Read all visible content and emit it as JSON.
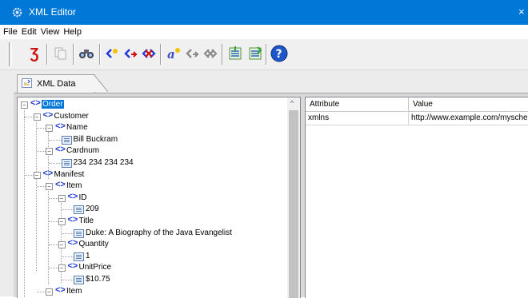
{
  "window": {
    "title": "XML Editor",
    "close_glyph": "×"
  },
  "menu": [
    "File",
    "Edit",
    "View",
    "Help"
  ],
  "toolbar": {
    "buttons": [
      "validate-icon",
      "copy-icon",
      "find-icon",
      "add-element-icon",
      "move-icon",
      "delete-element-icon",
      "add-attribute-icon",
      "move-attribute-icon",
      "delete-attribute-icon",
      "import-icon",
      "export-icon",
      "help-icon"
    ]
  },
  "tab": {
    "label": "XML Data"
  },
  "tree": [
    {
      "label": "Order",
      "depth": 0,
      "type": "root",
      "selected": true
    },
    {
      "label": "Customer",
      "depth": 1,
      "type": "element"
    },
    {
      "label": "Name",
      "depth": 2,
      "type": "element"
    },
    {
      "label": "Bill Buckram",
      "depth": 3,
      "type": "text"
    },
    {
      "label": "Cardnum",
      "depth": 2,
      "type": "attr-element"
    },
    {
      "label": "234 234 234 234",
      "depth": 3,
      "type": "text"
    },
    {
      "label": "Manifest",
      "depth": 1,
      "type": "element"
    },
    {
      "label": "Item",
      "depth": 2,
      "type": "element"
    },
    {
      "label": "ID",
      "depth": 3,
      "type": "element"
    },
    {
      "label": "209",
      "depth": 4,
      "type": "text"
    },
    {
      "label": "Title",
      "depth": 3,
      "type": "element"
    },
    {
      "label": "Duke: A Biography of the Java Evangelist",
      "depth": 4,
      "type": "text"
    },
    {
      "label": "Quantity",
      "depth": 3,
      "type": "element"
    },
    {
      "label": "1",
      "depth": 4,
      "type": "text"
    },
    {
      "label": "UnitPrice",
      "depth": 3,
      "type": "element"
    },
    {
      "label": "$10.75",
      "depth": 4,
      "type": "text"
    },
    {
      "label": "Item",
      "depth": 2,
      "type": "element"
    }
  ],
  "attributes": {
    "headers": [
      "Attribute",
      "Value"
    ],
    "rows": [
      [
        "xmlns",
        "http://www.example.com/mysche..."
      ]
    ]
  },
  "colors": {
    "titlebar": "#0078d7",
    "selection": "#0078d7",
    "element_icon": "#1f3bd6"
  }
}
